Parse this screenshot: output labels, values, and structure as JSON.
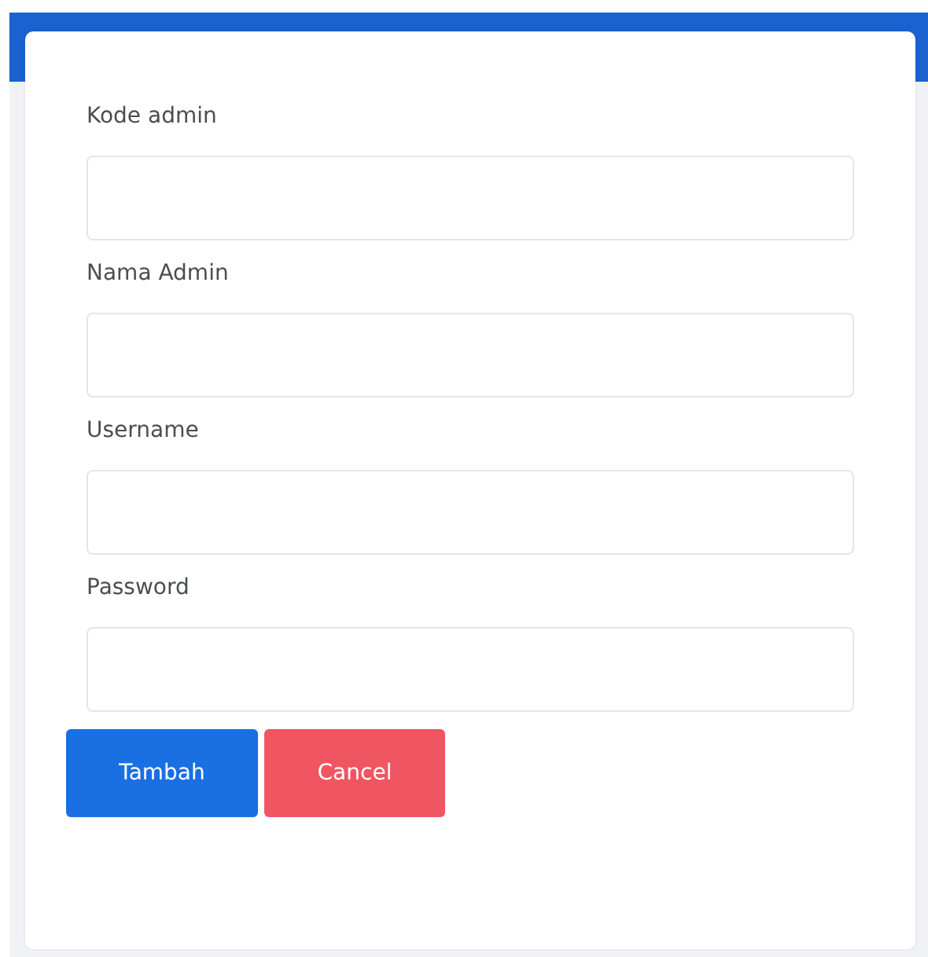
{
  "form": {
    "fields": [
      {
        "label": "Kode admin"
      },
      {
        "label": "Nama Admin"
      },
      {
        "label": "Username"
      },
      {
        "label": "Password"
      }
    ],
    "buttons": [
      {
        "label": "Tambah",
        "kind": "primary"
      },
      {
        "label": "Cancel",
        "kind": "danger"
      }
    ]
  }
}
